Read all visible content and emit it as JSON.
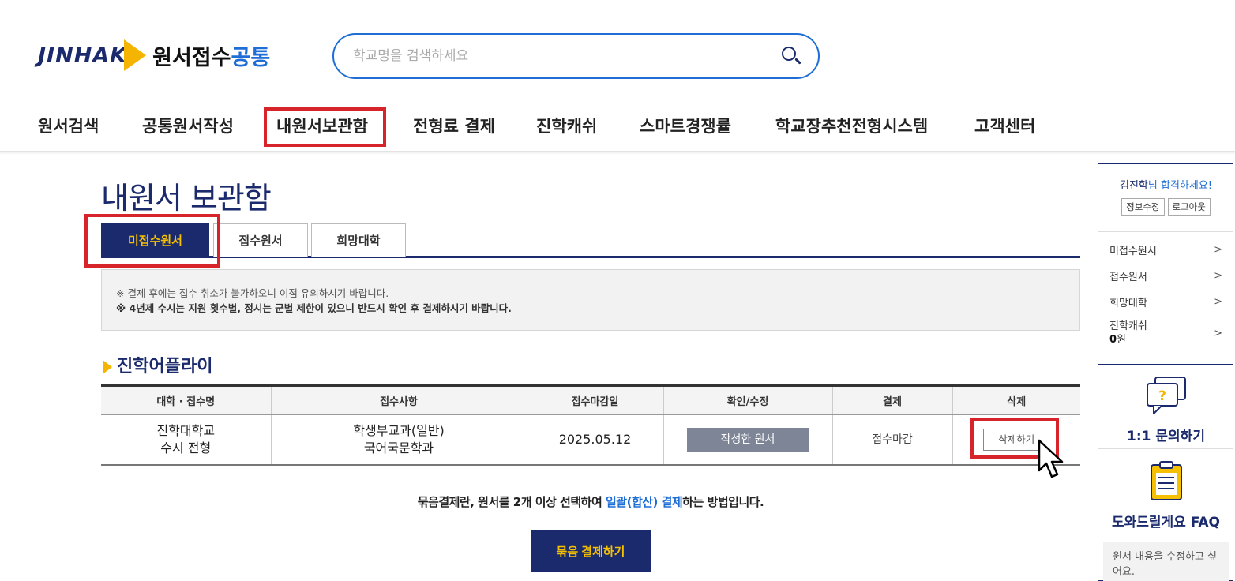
{
  "logo": {
    "brand": "JINHAK",
    "title_black": "원서접수",
    "title_blue": "공통"
  },
  "search": {
    "placeholder": "학교명을 검색하세요"
  },
  "nav": {
    "items": [
      "원서검색",
      "공통원서작성",
      "내원서보관함",
      "전형료 결제",
      "진학캐쉬",
      "스마트경쟁률",
      "학교장추천전형시스템",
      "고객센터"
    ],
    "highlighted": "내원서보관함"
  },
  "page_title": "내원서 보관함",
  "tabs": [
    "미접수원서",
    "접수원서",
    "희망대학"
  ],
  "active_tab": "미접수원서",
  "notice": {
    "line1": "※ 결제 후에는 접수 취소가 불가하오니 이점 유의하시기 바랍니다.",
    "line2": "※ 4년제 수시는 지원 횟수별, 정시는 군별 제한이 있으니 반드시 확인 후 결제하시기 바랍니다."
  },
  "section_title": "진학어플라이",
  "table": {
    "headers": [
      "대학 · 접수명",
      "접수사항",
      "접수마감일",
      "확인/수정",
      "결제",
      "삭제"
    ],
    "rows": [
      {
        "univ_line1": "진학대학교",
        "univ_line2": "수시 전형",
        "info_line1": "학생부교과(일반)",
        "info_line2": "국어국문학과",
        "deadline": "2025.05.12",
        "confirm_button": "작성한 원서",
        "payment_status": "접수마감",
        "delete_button": "삭제하기"
      }
    ]
  },
  "bundle": {
    "text_before": "묶음결제란, 원서를 2개 이상 선택하여 ",
    "text_highlight": "일괄(합산) 결제",
    "text_after": "하는 방법입니다.",
    "button": "묶음 결제하기"
  },
  "side": {
    "user_name": "김진학",
    "greeting": "님 합격하세요!",
    "edit_info": "정보수정",
    "logout": "로그아웃",
    "menu": [
      "미접수원서",
      "접수원서",
      "희망대학"
    ],
    "cash_label": "진학캐쉬",
    "cash_value": "0",
    "cash_unit": "원",
    "arrow": ">",
    "qa_label": "1:1 문의하기",
    "faq_label": "도와드릴게요 FAQ",
    "faq_question": "원서 내용을 수정하고 싶어요."
  },
  "colors": {
    "navy": "#1a2a6c",
    "yellow": "#f5b400",
    "blue": "#1e6ed6",
    "highlight_red": "#d7232a"
  }
}
